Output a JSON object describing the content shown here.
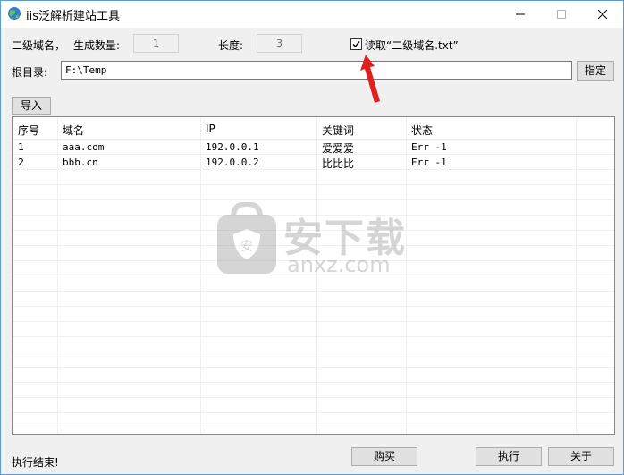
{
  "window": {
    "title": "iis泛解析建站工具"
  },
  "form": {
    "subdomain_label": "二级域名，",
    "count_label": "生成数量:",
    "count_value": "1",
    "length_label": "长度:",
    "length_value": "3",
    "read_checkbox_label": "读取“二级域名.txt”",
    "read_checkbox_checked": true,
    "root_label": "根目录:",
    "root_value": "F:\\Temp",
    "specify_button": "指定",
    "import_button": "导入"
  },
  "table": {
    "columns": [
      "序号",
      "域名",
      "IP",
      "关键词",
      "状态"
    ],
    "rows": [
      [
        "1",
        "aaa.com",
        "192.0.0.1",
        "爱爱爱",
        "Err -1"
      ],
      [
        "2",
        "bbb.cn",
        "192.0.0.2",
        "比比比",
        "Err -1"
      ]
    ]
  },
  "watermark": {
    "text_cn": "安下载",
    "text_en": "anxz.com"
  },
  "footer": {
    "status": "执行结束!",
    "buy_button": "购买",
    "execute_button": "执行",
    "about_button": "关于"
  },
  "colors": {
    "window_border": "#5a9bd5",
    "arrow": "#e0201e"
  }
}
